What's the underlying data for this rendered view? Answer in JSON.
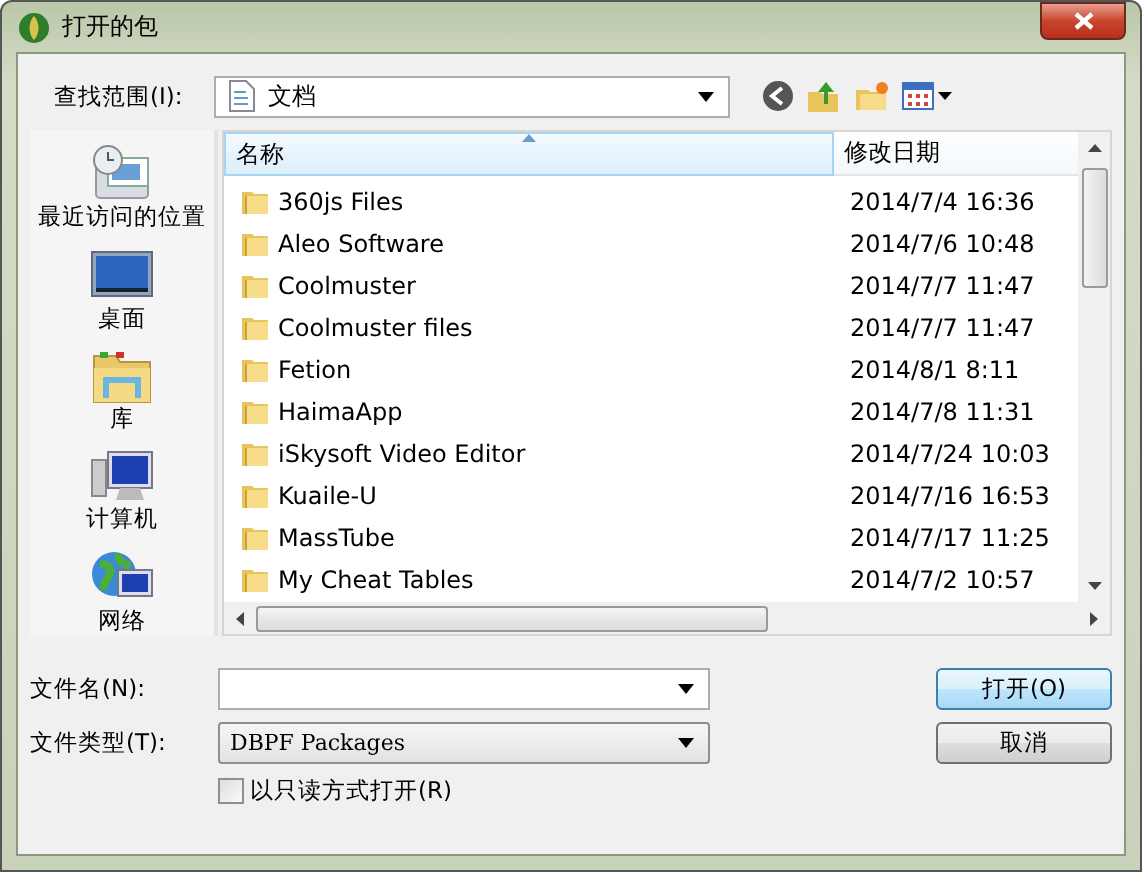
{
  "window": {
    "title": "打开的包"
  },
  "look_in": {
    "label": "查找范围(I):",
    "value": "文档"
  },
  "sidebar": {
    "items": [
      {
        "label": "最近访问的位置",
        "kind": "recent",
        "selected": false
      },
      {
        "label": "桌面",
        "kind": "desktop",
        "selected": false
      },
      {
        "label": "库",
        "kind": "library",
        "selected": false
      },
      {
        "label": "计算机",
        "kind": "computer",
        "selected": false
      },
      {
        "label": "网络",
        "kind": "network",
        "selected": false
      }
    ]
  },
  "file_list": {
    "columns": [
      "名称",
      "修改日期"
    ],
    "rows": [
      {
        "name": "360js Files",
        "date": "2014/7/4 16:36",
        "selected": false
      },
      {
        "name": "Aleo Software",
        "date": "2014/7/6 10:48",
        "selected": false
      },
      {
        "name": "Coolmuster",
        "date": "2014/7/7 11:47",
        "selected": false
      },
      {
        "name": "Coolmuster files",
        "date": "2014/7/7 11:47",
        "selected": false
      },
      {
        "name": "Fetion",
        "date": "2014/8/1 8:11",
        "selected": false
      },
      {
        "name": "HaimaApp",
        "date": "2014/7/8 11:31",
        "selected": false
      },
      {
        "name": "iSkysoft Video Editor",
        "date": "2014/7/24 10:03",
        "selected": false
      },
      {
        "name": "Kuaile-U",
        "date": "2014/7/16 16:53",
        "selected": false
      },
      {
        "name": "MassTube",
        "date": "2014/7/17 11:25",
        "selected": false
      },
      {
        "name": "My Cheat Tables",
        "date": "2014/7/2 10:57",
        "selected": false
      }
    ]
  },
  "file_name": {
    "label": "文件名(N):"
  },
  "file_type": {
    "label": "文件类型(T):",
    "value": "DBPF Packages"
  },
  "read_only": {
    "label": "以只读方式打开(R)",
    "checked": false
  },
  "buttons": [
    "打开(O)",
    "取消"
  ]
}
